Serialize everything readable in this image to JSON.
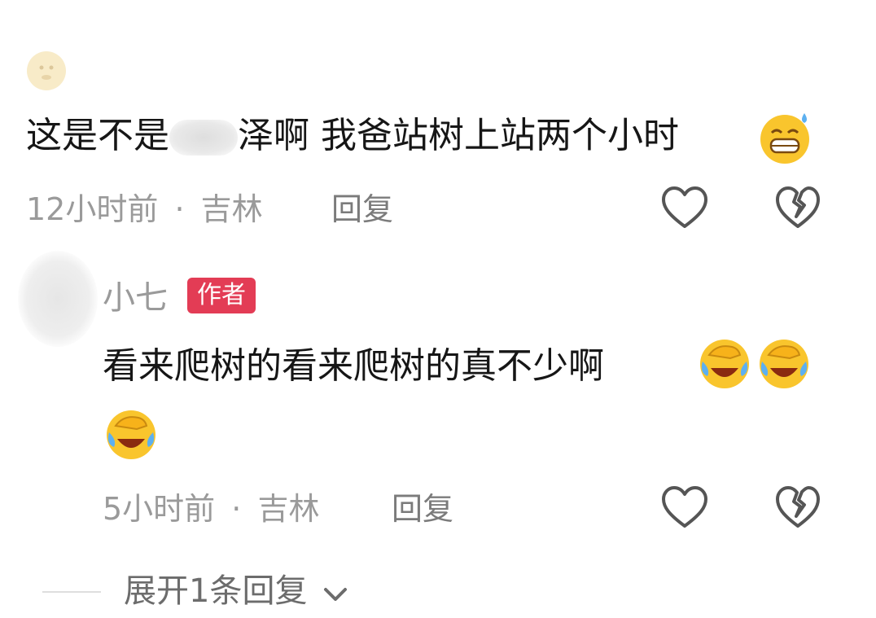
{
  "comments": [
    {
      "text_part1": "这是不是",
      "text_part2": "泽啊 我爸站树上站两个小时",
      "time": "12小时前",
      "separator": "·",
      "location": "吉林",
      "reply_label": "回复",
      "emoji": "grinning-sweat-icon"
    },
    {
      "author_name": "小七",
      "author_badge": "作者",
      "text_line1": "看来爬树的看来爬树的真不少啊",
      "time": "5小时前",
      "separator": "·",
      "location": "吉林",
      "reply_label": "回复",
      "emoji": "facepalm-laugh-icon"
    }
  ],
  "expand_label": "展开1条回复",
  "colors": {
    "badge": "#e33c55",
    "meta": "#9a9a9a",
    "text": "#161616"
  }
}
